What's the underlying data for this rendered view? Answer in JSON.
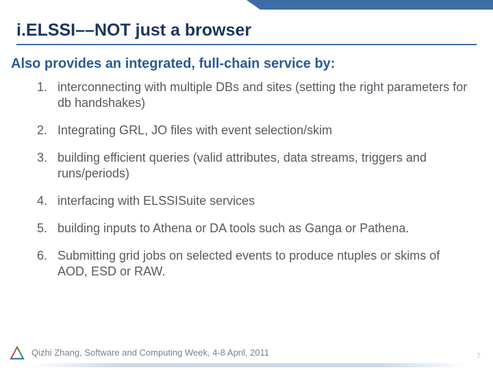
{
  "title": "i.ELSSI––NOT just a browser",
  "subtitle": "Also provides an integrated, full-chain service by:",
  "items": [
    "interconnecting with multiple DBs and sites (setting the right parameters for db handshakes)",
    "Integrating GRL, JO files with event selection/skim",
    "building efficient queries (valid attributes, data streams, triggers and runs/periods)",
    "interfacing with ELSSISuite services",
    "building inputs to Athena or DA tools such as Ganga or Pathena.",
    "Submitting grid jobs on selected events to produce ntuples or skims of AOD, ESD or RAW."
  ],
  "footer": "Qizhi Zhang, Software and Computing Week, 4-8 April, 2011",
  "page_number": "7"
}
